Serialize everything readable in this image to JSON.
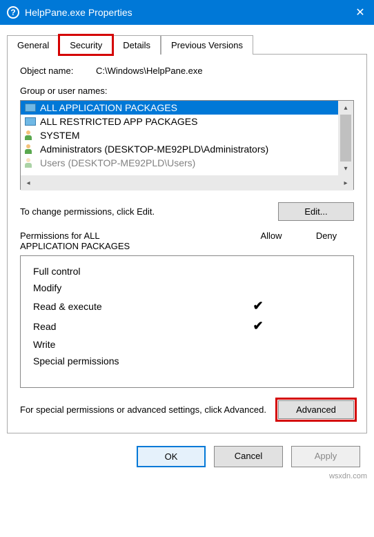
{
  "titlebar": {
    "help_icon_glyph": "?",
    "title": "HelpPane.exe Properties",
    "close_glyph": "✕"
  },
  "tabs": {
    "general": "General",
    "security": "Security",
    "details": "Details",
    "previous_versions": "Previous Versions"
  },
  "object_name": {
    "label": "Object name:",
    "value": "C:\\Windows\\HelpPane.exe"
  },
  "groups": {
    "label": "Group or user names:",
    "items": [
      "ALL APPLICATION PACKAGES",
      "ALL RESTRICTED APP PACKAGES",
      "SYSTEM",
      "Administrators (DESKTOP-ME92PLD\\Administrators)",
      "Users (DESKTOP-ME92PLD\\Users)"
    ]
  },
  "edit_row": {
    "text": "To change permissions, click Edit.",
    "button": "Edit..."
  },
  "permissions": {
    "heading_prefix": "Permissions for ALL",
    "heading_suffix": "APPLICATION PACKAGES",
    "allow": "Allow",
    "deny": "Deny",
    "rows": [
      {
        "name": "Full control",
        "allow": false,
        "deny": false
      },
      {
        "name": "Modify",
        "allow": false,
        "deny": false
      },
      {
        "name": "Read & execute",
        "allow": true,
        "deny": false
      },
      {
        "name": "Read",
        "allow": true,
        "deny": false
      },
      {
        "name": "Write",
        "allow": false,
        "deny": false
      },
      {
        "name": "Special permissions",
        "allow": false,
        "deny": false
      }
    ]
  },
  "advanced_row": {
    "text": "For special permissions or advanced settings, click Advanced.",
    "button": "Advanced"
  },
  "dialog_buttons": {
    "ok": "OK",
    "cancel": "Cancel",
    "apply": "Apply"
  },
  "watermark": "wsxdn.com"
}
